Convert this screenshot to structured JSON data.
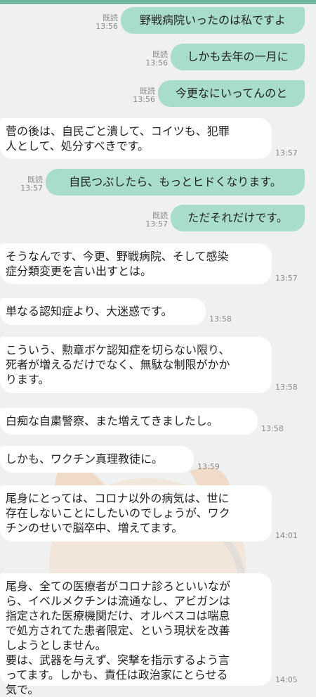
{
  "status": {
    "read": "既読"
  },
  "messages": [
    {
      "dir": "out",
      "text": "野戦病院いったのは私ですよ",
      "time": "13:56",
      "read": true
    },
    {
      "dir": "out",
      "text": "しかも去年の一月に",
      "time": "13:56",
      "read": true
    },
    {
      "dir": "out",
      "text": "今更なにいってんのと",
      "time": "13:56",
      "read": true
    },
    {
      "dir": "in",
      "text": "菅の後は、自民ごと潰して、コイツも、犯罪\n人として、処分すべきです。",
      "time": "13:57"
    },
    {
      "dir": "out",
      "text": "自民つぶしたら、もっとヒドくなります。",
      "time": "13:57",
      "read": true
    },
    {
      "dir": "out",
      "text": "ただそれだけです。",
      "time": "13:57",
      "read": true
    },
    {
      "dir": "in",
      "text": "そうなんです、今更、野戦病院、そして感染\n症分類変更を言い出すとは。",
      "time": "13:57"
    },
    {
      "dir": "in",
      "text": "単なる認知症より、大迷惑です。",
      "time": "13:58"
    },
    {
      "dir": "in",
      "text": "こういう、勲章ボケ認知症を切らない限り、\n死者が増えるだけでなく、無駄な制限がかか\nります。",
      "time": "13:58"
    },
    {
      "dir": "in",
      "text": "白痴な自粛警察、また増えてきましたし。",
      "time": "13:58"
    },
    {
      "dir": "in",
      "text": "しかも、ワクチン真理教徒に。",
      "time": "13:59"
    },
    {
      "dir": "in",
      "text": "尾身にとっては、コロナ以外の病気は、世に\n存在しないことにしたいのでしょうが、ワク\nチンのせいで脳卒中、増えてます。",
      "time": "14:01"
    },
    {
      "dir": "in",
      "text": "尾身、全ての医療者がコロナ診ろといいなが\nら、イベルメクチンは流通なし、アビガンは\n指定された医療機関だけ、オルベスコは喘息\nで処方されてた患者限定、という現状を改善\nしようとしません。\n要は、武器を与えず、突撃を指示するよう言\nってます。しかも、責任は政治家にとらせる\n気で。",
      "time": "14:05"
    }
  ]
}
